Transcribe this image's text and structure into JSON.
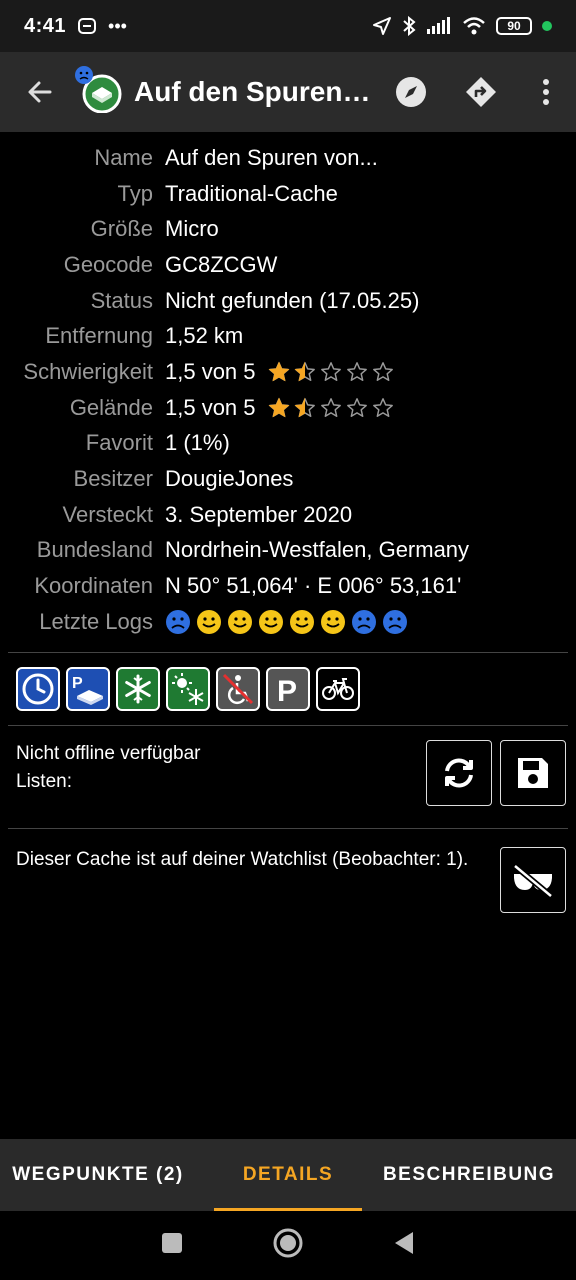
{
  "status_bar": {
    "time": "4:41",
    "battery": "90"
  },
  "app_bar": {
    "title": "Auf den Spuren…"
  },
  "details": [
    {
      "label": "Name",
      "value": "Auf den Spuren von..."
    },
    {
      "label": "Typ",
      "value": "Traditional-Cache"
    },
    {
      "label": "Größe",
      "value": "Micro"
    },
    {
      "label": "Geocode",
      "value": "GC8ZCGW"
    },
    {
      "label": "Status",
      "value": "Nicht gefunden (17.05.25)"
    },
    {
      "label": "Entfernung",
      "value": "1,52 km"
    },
    {
      "label": "Schwierigkeit",
      "value": "1,5 von 5",
      "rating": 1.5
    },
    {
      "label": "Gelände",
      "value": "1,5 von 5",
      "rating": 1.5
    },
    {
      "label": "Favorit",
      "value": "1 (1%)"
    },
    {
      "label": "Besitzer",
      "value": "DougieJones"
    },
    {
      "label": "Versteckt",
      "value": "3. September 2020"
    },
    {
      "label": "Bundesland",
      "value": "Nordrhein-Westfalen, Germany"
    },
    {
      "label": "Koordinaten",
      "value": "N 50° 51,064' · E 006° 53,161'"
    },
    {
      "label": "Letzte Logs",
      "logs": [
        "sad-blue",
        "happy",
        "happy",
        "happy",
        "happy",
        "happy",
        "sad-blue",
        "sad-blue"
      ]
    }
  ],
  "attributes": [
    "available-24h-icon",
    "parking-log-icon",
    "winter-icon",
    "seasonal-icon",
    "no-wheelchair-icon",
    "parking-icon",
    "bicycle-icon"
  ],
  "offline": {
    "line1": "Nicht offline verfügbar",
    "line2": "Listen:"
  },
  "watchlist": {
    "text": "Dieser Cache ist auf deiner Watchlist (Beobachter: 1)."
  },
  "tabs": [
    {
      "label": "WEGPUNKTE (2)",
      "active": false
    },
    {
      "label": "DETAILS",
      "active": true
    },
    {
      "label": "BESCHREIBUNG",
      "active": false
    }
  ],
  "colors": {
    "accent": "#f5a623",
    "star": "#f5a623",
    "attr_blue": "#1e4fb3",
    "attr_green": "#1f7a32",
    "attr_gray": "#555555"
  }
}
